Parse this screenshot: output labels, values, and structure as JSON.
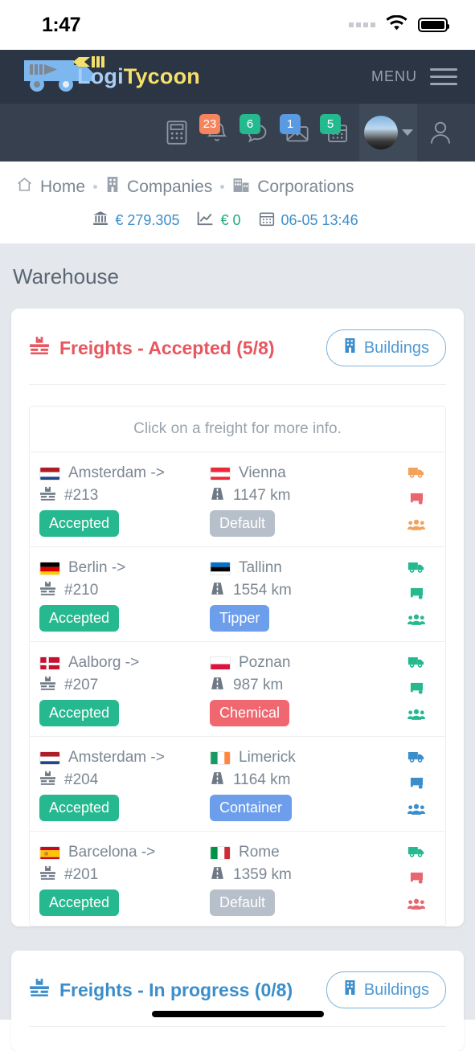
{
  "status_bar": {
    "time": "1:47",
    "signal_icon": "signal-dots-icon",
    "wifi_icon": "wifi-icon",
    "battery_icon": "battery-icon"
  },
  "header": {
    "logo_icon": "truck-logo-icon",
    "brand_first": "Logi",
    "brand_second": "Tycoon",
    "menu_label": "MENU",
    "hamburger_icon": "hamburger-icon"
  },
  "navicons": [
    {
      "name": "calculator-icon",
      "badge": null,
      "badge_color": null
    },
    {
      "name": "bell-icon",
      "badge": "23",
      "badge_color": "#f5855e"
    },
    {
      "name": "chat-icon",
      "badge": "6",
      "badge_color": "#25b98f"
    },
    {
      "name": "mail-icon",
      "badge": "1",
      "badge_color": "#5a9ae0"
    },
    {
      "name": "calendar-icon",
      "badge": "5",
      "badge_color": "#25b98f"
    }
  ],
  "account": {
    "avatar_icon": "avatar-image",
    "caret_icon": "chevron-down-icon",
    "user_icon": "user-icon"
  },
  "breadcrumb": [
    {
      "icon": "home-icon",
      "label": "Home"
    },
    {
      "icon": "building-icon",
      "label": "Companies"
    },
    {
      "icon": "corporations-icon",
      "label": "Corporations"
    }
  ],
  "stats": [
    {
      "icon": "bank-icon",
      "value": "€ 279.305",
      "color": "#3c8ecb"
    },
    {
      "icon": "chart-line-icon",
      "value": "€ 0",
      "color": "#1fa97f"
    },
    {
      "icon": "calendar-icon",
      "value": "06-05 13:46",
      "color": "#3c8ecb"
    }
  ],
  "page": {
    "title": "Warehouse"
  },
  "accepted_card": {
    "icon": "pallet-icon",
    "title": "Freights - Accepted (5/8)",
    "buildings_button": "Buildings",
    "buildings_icon": "building-icon",
    "hint": "Click on a freight for more info.",
    "rows": [
      {
        "origin_flag": "nl",
        "origin": "Amsterdam ->",
        "freight_icon": "pallet-icon",
        "freight_id": "#213",
        "status": "Accepted",
        "status_class": "accepted",
        "dest_flag": "at",
        "destination": "Vienna",
        "road_icon": "road-icon",
        "distance": "1147 km",
        "type": "Default",
        "type_class": "default",
        "action_colors": [
          "#f2a25c",
          "#e8666e",
          "#f2a25c"
        ]
      },
      {
        "origin_flag": "de",
        "origin": "Berlin ->",
        "freight_icon": "pallet-icon",
        "freight_id": "#210",
        "status": "Accepted",
        "status_class": "accepted",
        "dest_flag": "ee",
        "destination": "Tallinn",
        "road_icon": "road-icon",
        "distance": "1554 km",
        "type": "Tipper",
        "type_class": "tipper",
        "action_colors": [
          "#26b98f",
          "#26b98f",
          "#26b98f"
        ]
      },
      {
        "origin_flag": "dk",
        "origin": "Aalborg ->",
        "freight_icon": "pallet-icon",
        "freight_id": "#207",
        "status": "Accepted",
        "status_class": "accepted",
        "dest_flag": "pl",
        "destination": "Poznan",
        "road_icon": "road-icon",
        "distance": "987 km",
        "type": "Chemical",
        "type_class": "chemical",
        "action_colors": [
          "#26b98f",
          "#26b98f",
          "#26b98f"
        ]
      },
      {
        "origin_flag": "nl",
        "origin": "Amsterdam ->",
        "freight_icon": "pallet-icon",
        "freight_id": "#204",
        "status": "Accepted",
        "status_class": "accepted",
        "dest_flag": "ie",
        "destination": "Limerick",
        "road_icon": "road-icon",
        "distance": "1164 km",
        "type": "Container",
        "type_class": "container",
        "action_colors": [
          "#3c8ecb",
          "#3c8ecb",
          "#3c8ecb"
        ]
      },
      {
        "origin_flag": "es",
        "origin": "Barcelona ->",
        "freight_icon": "pallet-icon",
        "freight_id": "#201",
        "status": "Accepted",
        "status_class": "accepted",
        "dest_flag": "it",
        "destination": "Rome",
        "road_icon": "road-icon",
        "distance": "1359 km",
        "type": "Default",
        "type_class": "default",
        "action_colors": [
          "#26b98f",
          "#e8666e",
          "#e8666e"
        ]
      }
    ]
  },
  "progress_card": {
    "icon": "pallet-icon",
    "title": "Freights - In progress (0/8)",
    "buildings_button": "Buildings",
    "buildings_icon": "building-icon"
  }
}
